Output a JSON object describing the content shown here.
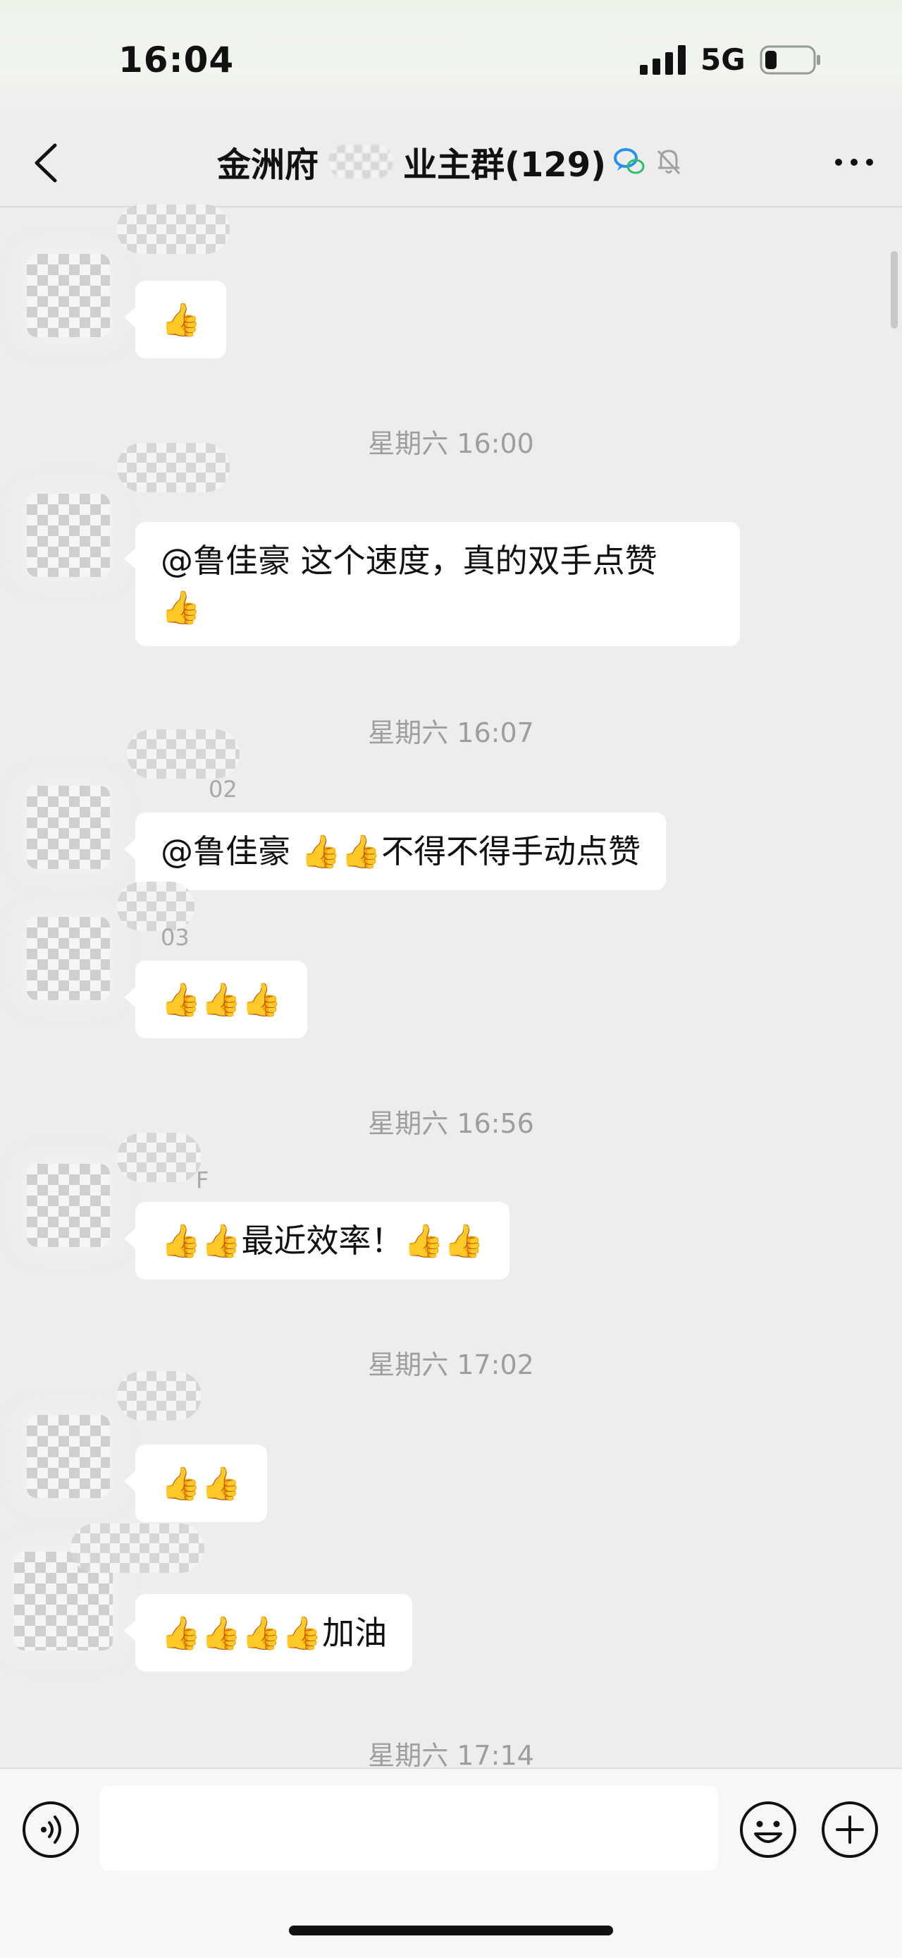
{
  "status": {
    "time": "16:04",
    "network": "5G"
  },
  "nav": {
    "title_prefix": "金洲府",
    "title_suffix": "业主群(129)"
  },
  "messages": [
    {
      "sender_tail": "",
      "text": "👍"
    },
    {
      "timestamp": "星期六 16:00"
    },
    {
      "sender_tail": "",
      "text": "@鲁佳豪 这个速度，真的双手点赞\n👍"
    },
    {
      "timestamp": "星期六 16:07"
    },
    {
      "sender_tail": "02",
      "text": "@鲁佳豪 👍👍不得不得手动点赞"
    },
    {
      "sender_tail": "03",
      "text": "👍👍👍"
    },
    {
      "timestamp": "星期六 16:56"
    },
    {
      "sender_tail": "F",
      "text": "👍👍最近效率！👍👍"
    },
    {
      "timestamp": "星期六 17:02"
    },
    {
      "sender_tail": "",
      "text": "👍👍"
    },
    {
      "sender_tail": "",
      "text": "👍👍👍👍加油"
    },
    {
      "timestamp": "星期六 17:14"
    }
  ],
  "input": {
    "placeholder": ""
  },
  "icons": {
    "back": "chevron-left-icon",
    "group_chat": "chat-bubbles-icon",
    "mute": "bell-muted-icon",
    "more": "more-dots-icon",
    "voice": "voice-icon",
    "emoji": "emoji-icon",
    "plus": "plus-icon"
  }
}
